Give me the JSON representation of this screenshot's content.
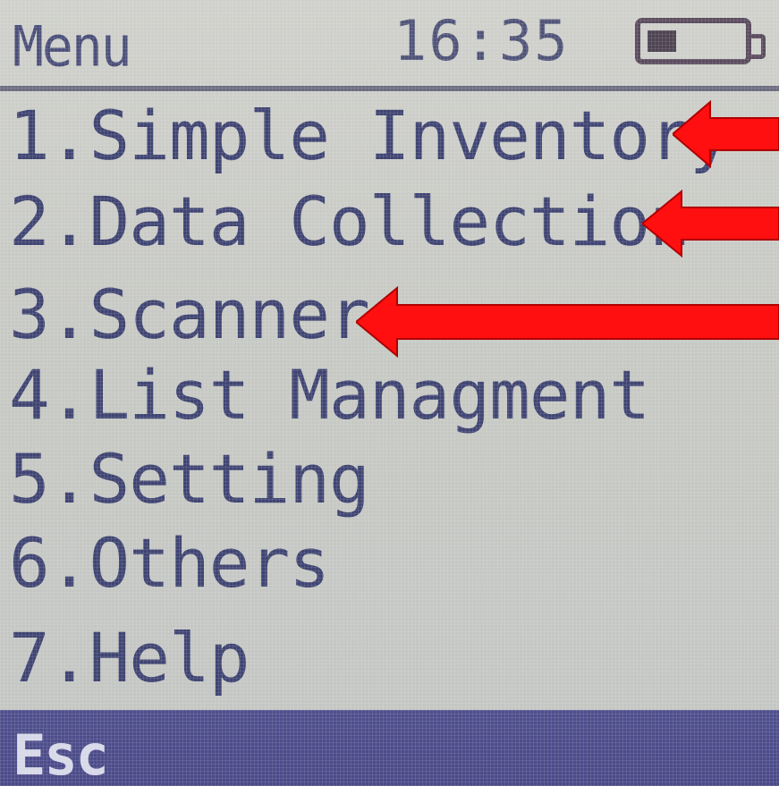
{
  "status": {
    "title": "Menu",
    "time": "16:35",
    "battery_icon": "battery-icon"
  },
  "menu": {
    "items": [
      {
        "label": "1.Simple Inventory",
        "annotated": true
      },
      {
        "label": "2.Data Collection",
        "annotated": true
      },
      {
        "label": "3.Scanner",
        "annotated": true
      },
      {
        "label": "4.List Managment",
        "annotated": false
      },
      {
        "label": "5.Setting",
        "annotated": false
      },
      {
        "label": "6.Others",
        "annotated": false
      },
      {
        "label": "7.Help",
        "annotated": false
      }
    ]
  },
  "softkeys": {
    "left": "Esc"
  },
  "colors": {
    "lcd_background": "#c9cac5",
    "lcd_text": "#3f4472",
    "softbar": "#4d4d8b",
    "annotation_arrow": "#ff1010"
  }
}
